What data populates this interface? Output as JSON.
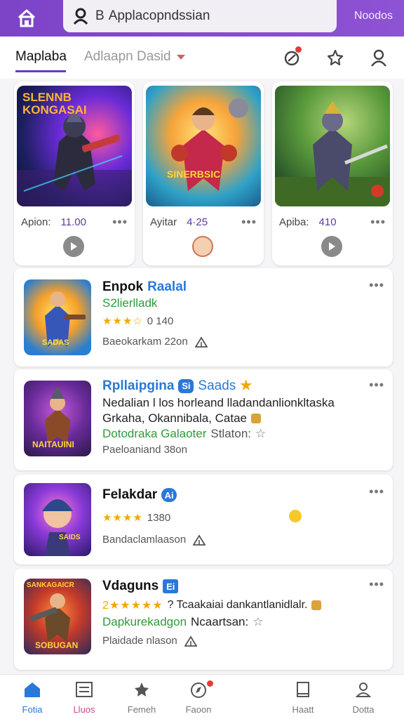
{
  "header": {
    "search_text": "Applacopndssian",
    "search_prefix": "B",
    "nav_right": "Noodos"
  },
  "tabs": {
    "active": "Maplaba",
    "second": "Adlaapn Dasid"
  },
  "featured": [
    {
      "label": "Apion:",
      "value": "11.00",
      "art_title": "SLENNB KONGASAI"
    },
    {
      "label": "Ayitar",
      "value": "4·25",
      "art_title": "SINERBSIC"
    },
    {
      "label": "Apiba:",
      "value": "410",
      "art_title": ""
    }
  ],
  "list": [
    {
      "title": "Enpok",
      "title_alt": "Raalal",
      "sub_green": "S2lierlladk",
      "rating": "0 140",
      "stars": "★★★☆",
      "foot": "Baeokarkam 22on",
      "thumb_caption": "SADAS"
    },
    {
      "title": "Rpllaipgina",
      "title_alt": "Saads",
      "badge": "Si",
      "line1": "Nedalian l los horleand lladandanlionkltaska",
      "line2": "Grkaha, Okannibala, Catae",
      "green": "Dotodraka Galaoter",
      "green_tail": "Stlaton:",
      "foot": "Paeloaniand 38on",
      "thumb_caption": "NAITAUINI"
    },
    {
      "title": "Felakdar",
      "badge": "Ai",
      "rating": "1380",
      "stars": "★★★★",
      "foot": "Bandaclamlaason",
      "thumb_caption": "SAIDS"
    },
    {
      "title": "Vdaguns",
      "badge": "Ei",
      "stars": "2★★★★★",
      "stars_text": "? Tcaakaiai dankantlanidlalr.",
      "green": "Dapkurekadgon",
      "green_tail": "Ncaartsan:",
      "foot": "Plaidade nlason",
      "thumb_caption": "SOBUGAN",
      "thumb_top": "SANKAGAICR"
    }
  ],
  "bottom_nav": [
    {
      "label": "Fotia",
      "icon": "home-icon"
    },
    {
      "label": "Lluos",
      "icon": "list-icon"
    },
    {
      "label": "Femeh",
      "icon": "star-icon"
    },
    {
      "label": "Faoon",
      "icon": "compass-icon"
    },
    {
      "label": "Haatt",
      "icon": "bookmark-icon"
    },
    {
      "label": "Dotta",
      "icon": "profile-icon"
    }
  ],
  "colors": {
    "accent": "#7d43c8",
    "link": "#2a78d8",
    "green": "#2e9b3a",
    "star": "#f0a800"
  }
}
